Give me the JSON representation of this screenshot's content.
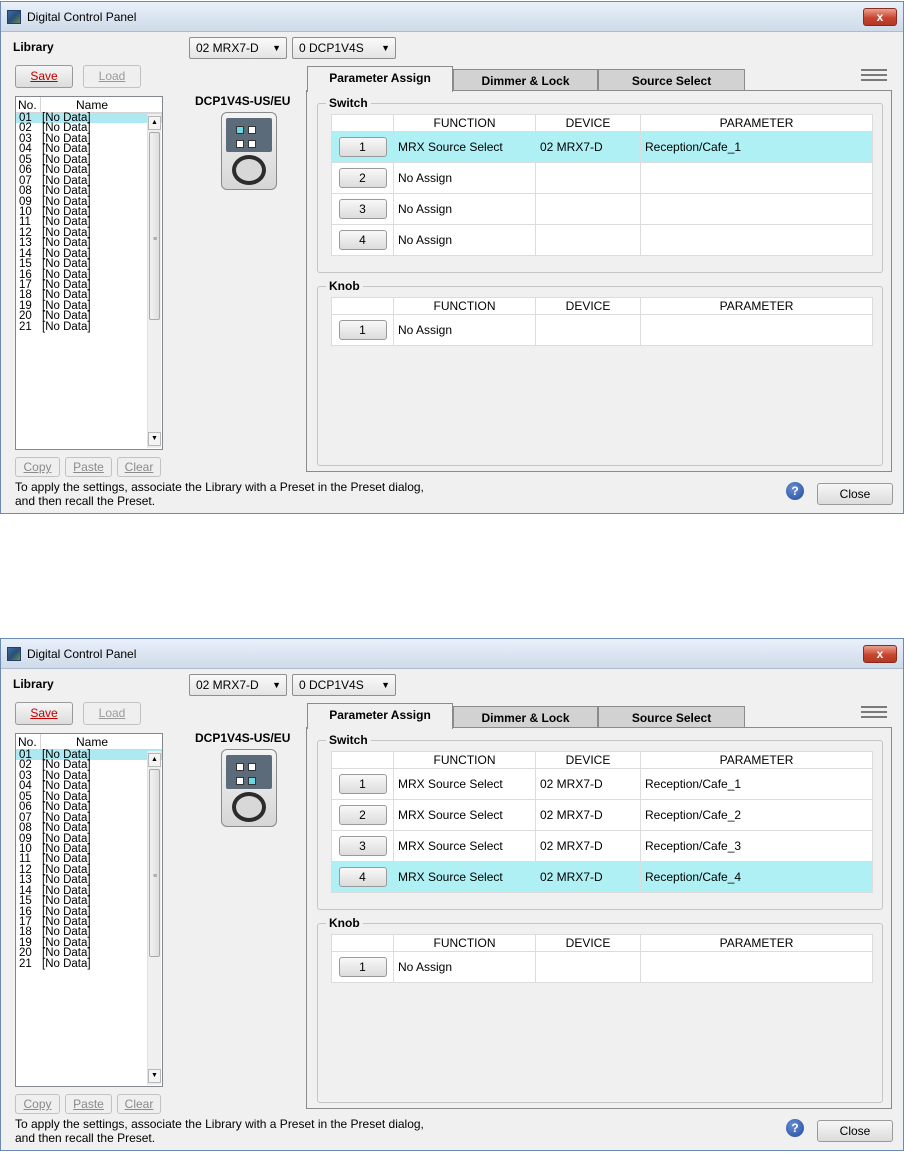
{
  "screens": [
    {
      "title": "Digital Control Panel",
      "close_glyph": "x",
      "library_label": "Library",
      "combo_device": "02 MRX7-D",
      "combo_panel": "0 DCP1V4S",
      "save_label": "Save",
      "load_label": "Load",
      "list_header_no": "No.",
      "list_header_name": "Name",
      "library_items": [
        {
          "no": "01",
          "name": "[No Data]"
        },
        {
          "no": "02",
          "name": "[No Data]"
        },
        {
          "no": "03",
          "name": "[No Data]"
        },
        {
          "no": "04",
          "name": "[No Data]"
        },
        {
          "no": "05",
          "name": "[No Data]"
        },
        {
          "no": "06",
          "name": "[No Data]"
        },
        {
          "no": "07",
          "name": "[No Data]"
        },
        {
          "no": "08",
          "name": "[No Data]"
        },
        {
          "no": "09",
          "name": "[No Data]"
        },
        {
          "no": "10",
          "name": "[No Data]"
        },
        {
          "no": "11",
          "name": "[No Data]"
        },
        {
          "no": "12",
          "name": "[No Data]"
        },
        {
          "no": "13",
          "name": "[No Data]"
        },
        {
          "no": "14",
          "name": "[No Data]"
        },
        {
          "no": "15",
          "name": "[No Data]"
        },
        {
          "no": "16",
          "name": "[No Data]"
        },
        {
          "no": "17",
          "name": "[No Data]"
        },
        {
          "no": "18",
          "name": "[No Data]"
        },
        {
          "no": "19",
          "name": "[No Data]"
        },
        {
          "no": "20",
          "name": "[No Data]"
        },
        {
          "no": "21",
          "name": "[No Data]"
        }
      ],
      "device_model": "DCP1V4S-US/EU",
      "tabs": [
        "Parameter Assign",
        "Dimmer & Lock",
        "Source Select"
      ],
      "switch_group_title": "Switch",
      "knob_group_title": "Knob",
      "col_function": "FUNCTION",
      "col_device": "DEVICE",
      "col_parameter": "PARAMETER",
      "switch_rows": [
        {
          "num": "1",
          "function": "MRX Source Select",
          "device": "02 MRX7-D",
          "parameter": "Reception/Cafe_1",
          "selected": true
        },
        {
          "num": "2",
          "function": "No Assign",
          "device": "",
          "parameter": "",
          "selected": false
        },
        {
          "num": "3",
          "function": "No Assign",
          "device": "",
          "parameter": "",
          "selected": false
        },
        {
          "num": "4",
          "function": "No Assign",
          "device": "",
          "parameter": "",
          "selected": false
        }
      ],
      "knob_rows": [
        {
          "num": "1",
          "function": "No Assign",
          "device": "",
          "parameter": "",
          "selected": false
        }
      ],
      "copy_label": "Copy",
      "paste_label": "Paste",
      "clear_label": "Clear",
      "apply_text_1": "To apply the settings, associate the Library with a Preset in the Preset dialog,",
      "apply_text_2": "and then recall the Preset.",
      "help_glyph": "?",
      "close_label": "Close"
    },
    {
      "title": "Digital Control Panel",
      "close_glyph": "x",
      "library_label": "Library",
      "combo_device": "02 MRX7-D",
      "combo_panel": "0 DCP1V4S",
      "save_label": "Save",
      "load_label": "Load",
      "list_header_no": "No.",
      "list_header_name": "Name",
      "library_items": [
        {
          "no": "01",
          "name": "[No Data]"
        },
        {
          "no": "02",
          "name": "[No Data]"
        },
        {
          "no": "03",
          "name": "[No Data]"
        },
        {
          "no": "04",
          "name": "[No Data]"
        },
        {
          "no": "05",
          "name": "[No Data]"
        },
        {
          "no": "06",
          "name": "[No Data]"
        },
        {
          "no": "07",
          "name": "[No Data]"
        },
        {
          "no": "08",
          "name": "[No Data]"
        },
        {
          "no": "09",
          "name": "[No Data]"
        },
        {
          "no": "10",
          "name": "[No Data]"
        },
        {
          "no": "11",
          "name": "[No Data]"
        },
        {
          "no": "12",
          "name": "[No Data]"
        },
        {
          "no": "13",
          "name": "[No Data]"
        },
        {
          "no": "14",
          "name": "[No Data]"
        },
        {
          "no": "15",
          "name": "[No Data]"
        },
        {
          "no": "16",
          "name": "[No Data]"
        },
        {
          "no": "17",
          "name": "[No Data]"
        },
        {
          "no": "18",
          "name": "[No Data]"
        },
        {
          "no": "19",
          "name": "[No Data]"
        },
        {
          "no": "20",
          "name": "[No Data]"
        },
        {
          "no": "21",
          "name": "[No Data]"
        }
      ],
      "device_model": "DCP1V4S-US/EU",
      "tabs": [
        "Parameter Assign",
        "Dimmer & Lock",
        "Source Select"
      ],
      "switch_group_title": "Switch",
      "knob_group_title": "Knob",
      "col_function": "FUNCTION",
      "col_device": "DEVICE",
      "col_parameter": "PARAMETER",
      "switch_rows": [
        {
          "num": "1",
          "function": "MRX Source Select",
          "device": "02 MRX7-D",
          "parameter": "Reception/Cafe_1",
          "selected": false
        },
        {
          "num": "2",
          "function": "MRX Source Select",
          "device": "02 MRX7-D",
          "parameter": "Reception/Cafe_2",
          "selected": false
        },
        {
          "num": "3",
          "function": "MRX Source Select",
          "device": "02 MRX7-D",
          "parameter": "Reception/Cafe_3",
          "selected": false
        },
        {
          "num": "4",
          "function": "MRX Source Select",
          "device": "02 MRX7-D",
          "parameter": "Reception/Cafe_4",
          "selected": true
        }
      ],
      "knob_rows": [
        {
          "num": "1",
          "function": "No Assign",
          "device": "",
          "parameter": "",
          "selected": false
        }
      ],
      "copy_label": "Copy",
      "paste_label": "Paste",
      "clear_label": "Clear",
      "apply_text_1": "To apply the settings, associate the Library with a Preset in the Preset dialog,",
      "apply_text_2": "and then recall the Preset.",
      "help_glyph": "?",
      "close_label": "Close"
    }
  ],
  "colors": {
    "row_highlight": "#aff0f4",
    "list_selected": "#aee9f2",
    "save_text": "#c00000",
    "title_close": "#c8452e"
  }
}
